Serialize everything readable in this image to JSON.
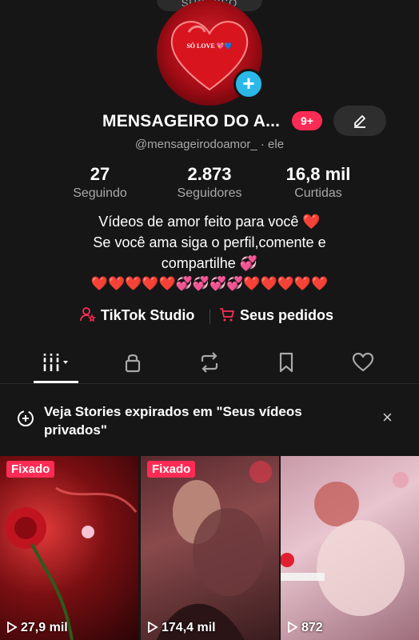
{
  "top_pill": {
    "label": "SUCESSO"
  },
  "avatar": {
    "text": "SÓ LOVE 💖💙"
  },
  "profile": {
    "name": "MENSAGEIRO DO A...",
    "notification_badge": "9+",
    "handle": "@mensageirodoamor_ · ele"
  },
  "stats": [
    {
      "value": "27",
      "label": "Seguindo"
    },
    {
      "value": "2.873",
      "label": "Seguidores"
    },
    {
      "value": "16,8 mil",
      "label": "Curtidas"
    }
  ],
  "bio": {
    "line1": "Vídeos de amor feito para você ❤️",
    "line2": "Se você ama siga o perfil,comente e",
    "line3": "compartilhe 💞",
    "line4": "❤️❤️❤️❤️❤️💞💞💞💞❤️❤️❤️❤️❤️"
  },
  "links": {
    "studio": "TikTok Studio",
    "orders": "Seus pedidos"
  },
  "tabs": [
    "videos-grid",
    "private",
    "reposts",
    "favorites",
    "liked"
  ],
  "stories_banner": {
    "text": "Veja Stories expirados em \"Seus vídeos privados\"",
    "close": "×"
  },
  "videos": [
    {
      "pinned": "Fixado",
      "views": "27,9 mil"
    },
    {
      "pinned": "Fixado",
      "views": "174,4 mil"
    },
    {
      "pinned": "",
      "views": "872"
    }
  ],
  "colors": {
    "accent": "#fe2c55",
    "plus": "#2bb8e8",
    "background": "#161616",
    "muted": "#a8a8a8"
  }
}
